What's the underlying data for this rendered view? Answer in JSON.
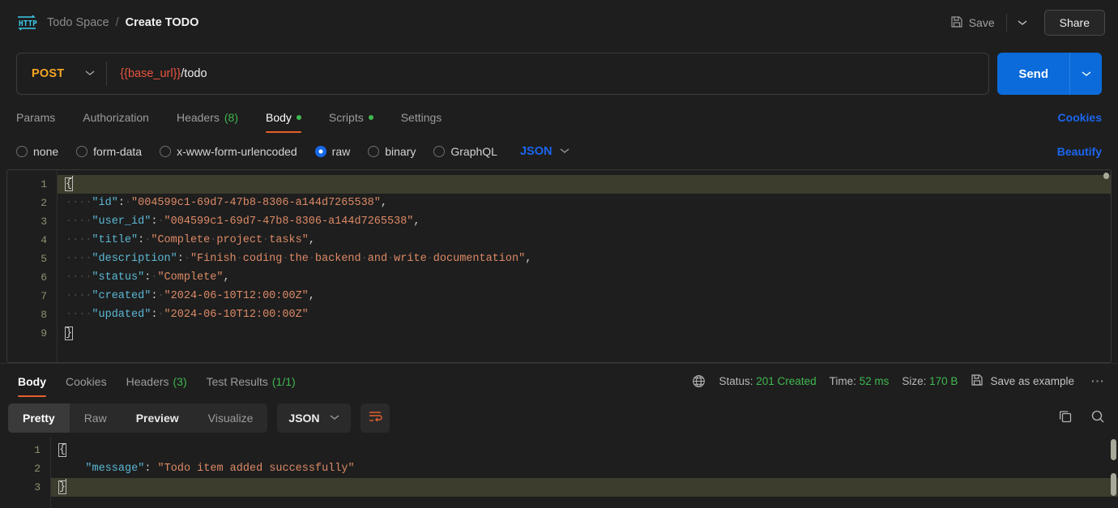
{
  "header": {
    "app_icon": "http-icon",
    "workspace": "Todo Space",
    "separator": "/",
    "request_name": "Create TODO",
    "save_label": "Save",
    "save_icon": "floppy-disk-icon",
    "save_caret_icon": "chevron-down-icon",
    "share_label": "Share"
  },
  "url_bar": {
    "method": "POST",
    "method_caret_icon": "chevron-down-icon",
    "url_variable": "{{base_url}}",
    "url_path": "/todo",
    "send_label": "Send",
    "send_caret_icon": "chevron-down-icon"
  },
  "request_tabs": {
    "items": [
      {
        "label": "Params",
        "count": "",
        "dot": false,
        "active": false
      },
      {
        "label": "Authorization",
        "count": "",
        "dot": false,
        "active": false
      },
      {
        "label": "Headers",
        "count": "(8)",
        "dot": false,
        "active": false
      },
      {
        "label": "Body",
        "count": "",
        "dot": true,
        "active": true
      },
      {
        "label": "Scripts",
        "count": "",
        "dot": true,
        "active": false
      },
      {
        "label": "Settings",
        "count": "",
        "dot": false,
        "active": false
      }
    ],
    "cookies_label": "Cookies"
  },
  "body_type": {
    "options": [
      {
        "label": "none",
        "selected": false
      },
      {
        "label": "form-data",
        "selected": false
      },
      {
        "label": "x-www-form-urlencoded",
        "selected": false
      },
      {
        "label": "raw",
        "selected": true
      },
      {
        "label": "binary",
        "selected": false
      },
      {
        "label": "GraphQL",
        "selected": false
      }
    ],
    "format": "JSON",
    "format_caret_icon": "chevron-down-icon",
    "beautify_label": "Beautify"
  },
  "request_body": {
    "line_numbers": [
      "1",
      "2",
      "3",
      "4",
      "5",
      "6",
      "7",
      "8",
      "9"
    ],
    "lines": [
      {
        "n": 1,
        "active": true,
        "indent": 0,
        "key": "",
        "value": "",
        "brace": "{",
        "comma": false
      },
      {
        "n": 2,
        "active": false,
        "indent": 4,
        "key": "id",
        "value": "004599c1-69d7-47b8-8306-a144d7265538",
        "brace": "",
        "comma": true
      },
      {
        "n": 3,
        "active": false,
        "indent": 4,
        "key": "user_id",
        "value": "004599c1-69d7-47b8-8306-a144d7265538",
        "brace": "",
        "comma": true
      },
      {
        "n": 4,
        "active": false,
        "indent": 4,
        "key": "title",
        "value": "Complete project tasks",
        "brace": "",
        "comma": true
      },
      {
        "n": 5,
        "active": false,
        "indent": 4,
        "key": "description",
        "value": "Finish coding the backend and write documentation",
        "brace": "",
        "comma": true
      },
      {
        "n": 6,
        "active": false,
        "indent": 4,
        "key": "status",
        "value": "Complete",
        "brace": "",
        "comma": true
      },
      {
        "n": 7,
        "active": false,
        "indent": 4,
        "key": "created",
        "value": "2024-06-10T12:00:00Z",
        "brace": "",
        "comma": true
      },
      {
        "n": 8,
        "active": false,
        "indent": 4,
        "key": "updated",
        "value": "2024-06-10T12:00:00Z",
        "brace": "",
        "comma": false
      },
      {
        "n": 9,
        "active": false,
        "indent": 0,
        "key": "",
        "value": "",
        "brace": "}",
        "comma": false
      }
    ]
  },
  "response_tabs": {
    "items": [
      {
        "label": "Body",
        "count": "",
        "active": true
      },
      {
        "label": "Cookies",
        "count": "",
        "active": false
      },
      {
        "label": "Headers",
        "count": "(3)",
        "active": false
      },
      {
        "label": "Test Results",
        "count": "(1/1)",
        "active": false
      }
    ],
    "network_icon": "globe-icon",
    "status_label": "Status:",
    "status_value": "201 Created",
    "time_label": "Time:",
    "time_value": "52 ms",
    "size_label": "Size:",
    "size_value": "170 B",
    "save_example_icon": "floppy-disk-icon",
    "save_example_label": "Save as example",
    "more_icon": "ellipsis-icon"
  },
  "response_toolbar": {
    "views": [
      {
        "label": "Pretty",
        "active": true
      },
      {
        "label": "Raw",
        "active": false
      },
      {
        "label": "Preview",
        "active": false
      },
      {
        "label": "Visualize",
        "active": false
      }
    ],
    "format": "JSON",
    "format_caret_icon": "chevron-down-icon",
    "wrap_icon": "wrap-text-icon",
    "copy_icon": "copy-icon",
    "search_icon": "search-icon"
  },
  "response_body": {
    "line_numbers": [
      "1",
      "2",
      "3"
    ],
    "lines": [
      {
        "n": 1,
        "active": false,
        "indent": 0,
        "key": "",
        "value": "",
        "brace": "{",
        "comma": false
      },
      {
        "n": 2,
        "active": false,
        "indent": 4,
        "key": "message",
        "value": "Todo item added successfully",
        "brace": "",
        "comma": false
      },
      {
        "n": 3,
        "active": true,
        "indent": 0,
        "key": "",
        "value": "",
        "brace": "}",
        "comma": false
      }
    ]
  },
  "colors": {
    "accent_orange": "#e35f2d",
    "link_blue": "#1a66ef",
    "send_blue": "#0b6bdb",
    "status_green": "#3fb950",
    "method_orange": "#f5a623",
    "var_red": "#e8543f",
    "json_key": "#5bb8d4",
    "json_string": "#dd8a66",
    "background": "#1e1e1e"
  }
}
